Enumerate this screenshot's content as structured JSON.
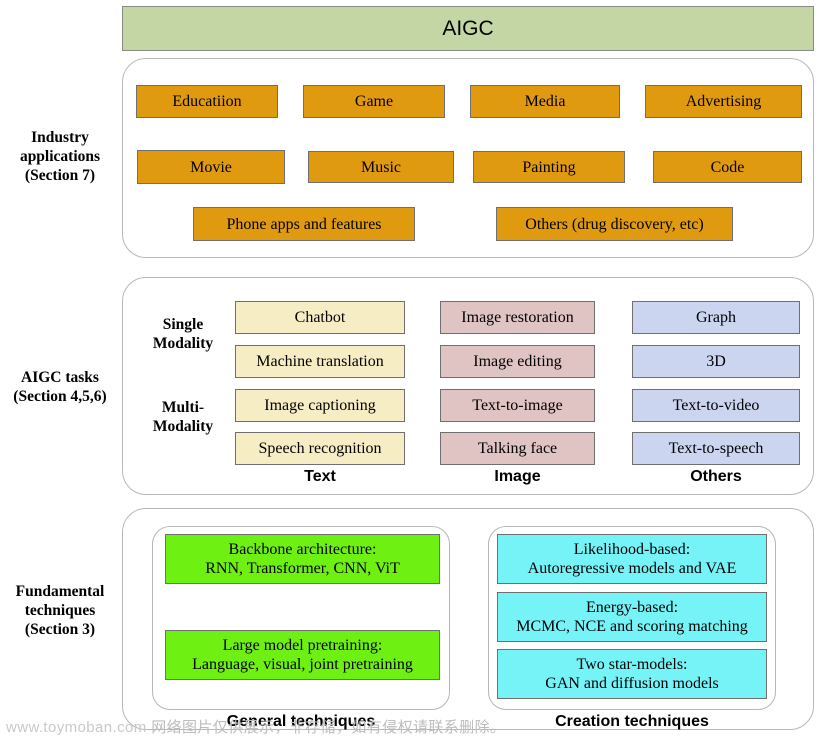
{
  "title": "AIGC",
  "colors": {
    "aigc_bar": "#c3d6a3",
    "industry": "#e09a0f",
    "text_tasks": "#f7edc4",
    "image_tasks": "#e0c4c4",
    "other_tasks": "#ccd5f0",
    "general_techniques": "#6ef013",
    "creation_techniques": "#76f3f7"
  },
  "sections": {
    "industry": {
      "label": "Industry\napplications\n(Section 7)",
      "label_lines": [
        "Industry",
        "applications",
        "(Section 7)"
      ],
      "rows": [
        [
          "Educatiion",
          "Game",
          "Media",
          "Advertising"
        ],
        [
          "Movie",
          "Music",
          "Painting",
          "Code"
        ],
        [
          "Phone apps and features",
          "Others (drug discovery, etc)"
        ]
      ]
    },
    "tasks": {
      "label_lines": [
        "AIGC tasks",
        "(Section 4,5,6)"
      ],
      "modality": {
        "single": [
          "Single",
          "Modality"
        ],
        "multi": [
          "Multi-",
          "Modality"
        ]
      },
      "columns": [
        {
          "caption": "Text",
          "items": [
            "Chatbot",
            "Machine translation",
            "Image captioning",
            "Speech recognition"
          ]
        },
        {
          "caption": "Image",
          "items": [
            "Image restoration",
            "Image editing",
            "Text-to-image",
            "Talking face"
          ]
        },
        {
          "caption": "Others",
          "items": [
            "Graph",
            "3D",
            "Text-to-video",
            "Text-to-speech"
          ]
        }
      ]
    },
    "fundamental": {
      "label_lines": [
        "Fundamental",
        "techniques",
        "(Section 3)"
      ],
      "general": {
        "caption": "General techniques",
        "items": [
          {
            "line1": "Backbone architecture:",
            "line2": "RNN, Transformer, CNN, ViT"
          },
          {
            "line1": "Large model pretraining:",
            "line2": "Language, visual, joint pretraining"
          }
        ]
      },
      "creation": {
        "caption": "Creation techniques",
        "items": [
          {
            "line1": "Likelihood-based:",
            "line2": "Autoregressive models and VAE"
          },
          {
            "line1": "Energy-based:",
            "line2": "MCMC, NCE and scoring matching"
          },
          {
            "line1": "Two star-models:",
            "line2": "GAN and diffusion models"
          }
        ]
      }
    }
  },
  "watermark": {
    "url": "www.toymoban.com",
    "notice": "网络图片仅供展示，非存储，如有侵权请联系删除。"
  }
}
